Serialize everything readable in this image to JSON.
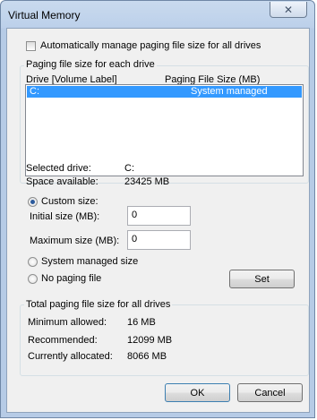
{
  "window": {
    "title": "Virtual Memory",
    "close_glyph": "✕"
  },
  "auto_manage": {
    "label": "Automatically manage paging file size for all drives",
    "checked": false
  },
  "drives_group": {
    "legend": "Paging file size for each drive",
    "col_drive": "Drive  [Volume Label]",
    "col_size": "Paging File Size (MB)",
    "rows": [
      {
        "drive": "C:",
        "size": "System managed"
      }
    ]
  },
  "selected": {
    "drive_label": "Selected drive:",
    "drive_value": "C:",
    "space_label": "Space available:",
    "space_value": "23425 MB"
  },
  "options": {
    "custom_label": "Custom size:",
    "initial_label": "Initial size (MB):",
    "initial_value": "0",
    "max_label": "Maximum size (MB):",
    "max_value": "0",
    "system_label": "System managed size",
    "none_label": "No paging file",
    "selected_option": "custom",
    "set_label": "Set"
  },
  "totals_group": {
    "legend": "Total paging file size for all drives",
    "min_label": "Minimum allowed:",
    "min_value": "16 MB",
    "rec_label": "Recommended:",
    "rec_value": "12099 MB",
    "cur_label": "Currently allocated:",
    "cur_value": "8066 MB"
  },
  "buttons": {
    "ok": "OK",
    "cancel": "Cancel"
  }
}
